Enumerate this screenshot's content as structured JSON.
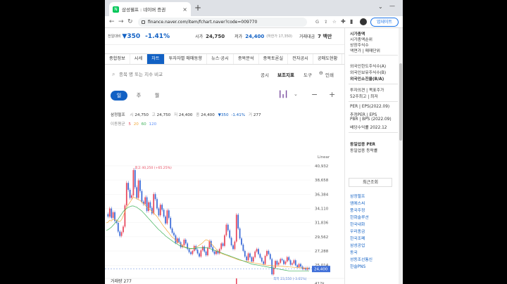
{
  "browser": {
    "tab_title": "삼성웰프 : 네이버 증권",
    "favicon_letter": "N",
    "new_tab": "+",
    "close": "×",
    "url": "finance.naver.com/item/fchart.naver?code=009770",
    "update_button": "업데이트"
  },
  "price_bar": {
    "change_label": "전일대비",
    "change_value": "▼350",
    "change_pct": "-1.41%",
    "high_label": "시가",
    "open_value": "24,750",
    "low_label": "저가",
    "low_value": "24,400",
    "low_note": "(하한가 17,350)",
    "volume_label": "거래대금",
    "volume_value": "7 백만"
  },
  "tabs": [
    "종합정보",
    "시세",
    "차트",
    "투자자별 매매동향",
    "뉴스·공시",
    "종목분석",
    "종목토론실",
    "전자공시",
    "공매도현황"
  ],
  "active_tab_index": 2,
  "search": {
    "placeholder": "종목 명 또는 지수 비교",
    "links": [
      "공시",
      "보조지표",
      "도구",
      "인쇄"
    ]
  },
  "period": {
    "buttons": [
      "일",
      "주",
      "월"
    ],
    "active_index": 0
  },
  "info": {
    "name": "삼정펄프",
    "open_label": "시",
    "open": "24,750",
    "high_label": "고",
    "high": "24,750",
    "low_label": "저",
    "low": "24,400",
    "close_label": "종",
    "close": "24,400",
    "change": "▼350",
    "change_pct": "-1.41%",
    "vol_label": "거",
    "vol": "277",
    "ma_label": "이동평균",
    "ma_periods": [
      "5",
      "20",
      "60",
      "120"
    ],
    "ma_colors": [
      "#e84a5f",
      "#f2a93b",
      "#3fb15a",
      "#5b8ff9"
    ]
  },
  "chart": {
    "scale_label": "Linear",
    "y_ticks": [
      "40,932",
      "38,658",
      "36,384",
      "34,110",
      "31,836",
      "29,562",
      "27,288",
      "25,014"
    ],
    "current_price_tag": "24,400",
    "max_label": "최고 40,250 (+65.25%)",
    "min_label": "최저 23,550 (-3.61%)",
    "volume_label": "거래량",
    "volume_value": "277",
    "volume_tick": "412k"
  },
  "chart_data": {
    "type": "line",
    "title": "",
    "ylabel": "",
    "ylim": [
      23800,
      41600
    ],
    "series": [
      {
        "values": [
          33200,
          32800,
          34100,
          32600,
          33500,
          32100,
          31800,
          30400,
          29700,
          30300,
          31200,
          34600,
          38200,
          37100,
          35800,
          36200,
          40250,
          37500,
          35800,
          38600,
          36900,
          35200,
          34800,
          35900,
          33700,
          35100,
          34200,
          33300,
          36400,
          35600,
          34100,
          33000,
          34700,
          33900,
          32800,
          31700,
          33800,
          32600,
          30900,
          30200,
          29800,
          28600,
          29300,
          28700,
          27900,
          28200,
          29100,
          28500,
          27600,
          27100,
          26800,
          27300,
          28100,
          27500,
          26900,
          26400,
          27400,
          28000,
          27200,
          26600,
          27800,
          28900,
          27900,
          27200,
          26800,
          27300,
          26900,
          27600,
          28500,
          28100,
          29800,
          31500,
          30600,
          29400,
          28200,
          27600,
          28800,
          33100,
          30900,
          29300,
          28300,
          27300,
          26400,
          25800,
          26900,
          26300,
          25600,
          26300,
          27200,
          27600,
          26800,
          26200,
          25600,
          25200,
          26500,
          27300,
          26800,
          26000,
          23550,
          24600,
          25700,
          25100,
          25400,
          26000,
          25800,
          25200,
          25600,
          26300,
          25800,
          25100,
          25300,
          25800,
          25000,
          24700,
          25200,
          24800,
          24400,
          24600,
          24300,
          24600,
          24400
        ]
      },
      {
        "values": [
          31800,
          31900,
          32200,
          32100,
          32400,
          32300,
          32200,
          32100,
          32000,
          32300,
          32900,
          33600,
          34300,
          34700,
          35100,
          35500,
          35900,
          35800,
          35700,
          35500,
          35400,
          35100,
          34900,
          34600,
          34300,
          34100,
          33900,
          33600,
          33400,
          33100,
          32800,
          32400,
          32000,
          31600,
          31200,
          30900,
          30500,
          30200,
          29800,
          29500,
          29300,
          29000,
          28800,
          28600,
          28400,
          28200,
          28000,
          27900,
          27800,
          27700,
          27600,
          27700,
          27800,
          27900,
          28000,
          28200,
          28400,
          28600,
          28900,
          29100,
          29000,
          28800,
          28500,
          28200,
          27900,
          27600,
          27300,
          27100,
          26900,
          26800,
          26700,
          26600,
          26500,
          26400,
          26300,
          26200,
          26100,
          26000,
          25900,
          25800,
          25750,
          25700,
          25650,
          25600,
          25550,
          25500,
          25450,
          25400,
          25350,
          25300,
          25250,
          25200,
          25150,
          25100,
          25050,
          25000,
          24980,
          24960,
          24940,
          24920,
          24900,
          24880,
          24860,
          24840,
          24820,
          24800,
          24780,
          24760,
          24740,
          24720,
          24700,
          24680,
          24660,
          24640,
          24620,
          24600,
          24580,
          24560,
          24540,
          24520,
          24500
        ]
      },
      {
        "values": [
          30600,
          30700,
          30900,
          31100,
          31400,
          31700,
          32000,
          32400,
          32800,
          33200,
          33600,
          33900,
          34100,
          34300,
          34400,
          34500,
          34500,
          34400,
          34300,
          34100,
          33900,
          33700,
          33400,
          33100,
          32800,
          32500,
          32200,
          31900,
          31600,
          31300,
          31000,
          30700,
          30500,
          30200,
          30000,
          29700,
          29500,
          29300,
          29100,
          28900,
          28700,
          28500,
          28400,
          28200,
          28100,
          28000,
          27900,
          27800,
          27800,
          27700,
          27700,
          27700,
          27700,
          27700,
          27800,
          27800,
          27800,
          27800,
          27800,
          27800,
          27800,
          27700,
          27600,
          27500,
          27400,
          27300,
          27200,
          27100,
          27000,
          26900,
          26800,
          26700,
          26600,
          26500,
          26400,
          26300,
          26200,
          26100,
          26000,
          25900,
          25800,
          25700,
          25600,
          25500,
          25400,
          25300,
          25200,
          25150,
          25100,
          25050,
          25000,
          24950,
          24900,
          24850,
          24800,
          24750,
          24700,
          24650,
          24600,
          24550,
          24500,
          24450,
          24400,
          24350,
          24300,
          24250,
          24200,
          24150,
          24100,
          24100,
          24100,
          24100,
          24100,
          24100,
          24100,
          24100,
          24100,
          24100,
          24100,
          24100,
          24100
        ]
      }
    ]
  },
  "sidebar": {
    "top_items": [
      "시가총액",
      "시가총액순위",
      "상장주식수",
      "액면가 | 매매단위"
    ],
    "foreign_items": [
      "외국인한도주식수(A)",
      "외국인보유주식수(B)",
      "외국인소진율(B/A)"
    ],
    "opinion_items": [
      "투자의견 | 목표주가",
      "52주최고 | 최저"
    ],
    "per_items": [
      "PER | EPS(2022.09)",
      "추정PER | EPS",
      "PBR | BPS (2022.09)",
      "배당수익률 2022.12"
    ],
    "industry_items": [
      "동일업종 PER",
      "동일업종 등락률"
    ],
    "recent_header": "최근조회",
    "recent_items": [
      "삼정펄프",
      "엠에스씨",
      "풍국주정",
      "한화솔루션",
      "한국내화",
      "우리종금",
      "한국조폐",
      "삼성공업",
      "동국",
      "성동조선통신",
      "한솔PNS"
    ]
  }
}
